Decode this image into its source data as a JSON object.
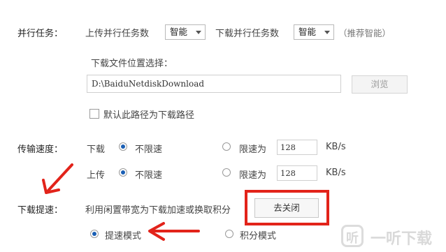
{
  "parallel": {
    "label": "并行任务：",
    "upload_label": "上传并行任务数",
    "upload_value": "智能",
    "download_label": "下载并行任务数",
    "download_value": "智能",
    "hint": "（推荐智能）"
  },
  "download_location": {
    "label": "下载文件位置选择：",
    "path": "D:\\BaiduNetdiskDownload",
    "browse_label": "浏览",
    "default_checkbox_label": "默认此路径为下载路径",
    "default_checked": false
  },
  "transfer_speed": {
    "label": "传输速度：",
    "download": {
      "label": "下载",
      "unlimited_label": "不限速",
      "limit_label": "限速为",
      "limit_value": "128",
      "unit": "KB/s",
      "selected": "unlimited"
    },
    "upload": {
      "label": "上传",
      "unlimited_label": "不限速",
      "limit_label": "限速为",
      "limit_value": "128",
      "unit": "KB/s",
      "selected": "unlimited"
    }
  },
  "download_boost": {
    "label": "下载提速：",
    "description": "利用闲置带宽为下载加速或换取积分",
    "close_button_label": "去关闭",
    "mode_speed_label": "提速模式",
    "mode_points_label": "积分模式",
    "selected": "speed"
  },
  "watermark": {
    "text": "一听下载",
    "logo_char": "听"
  },
  "colors": {
    "annotation_red": "#e2231a",
    "radio_selected": "#1a5fb4"
  }
}
